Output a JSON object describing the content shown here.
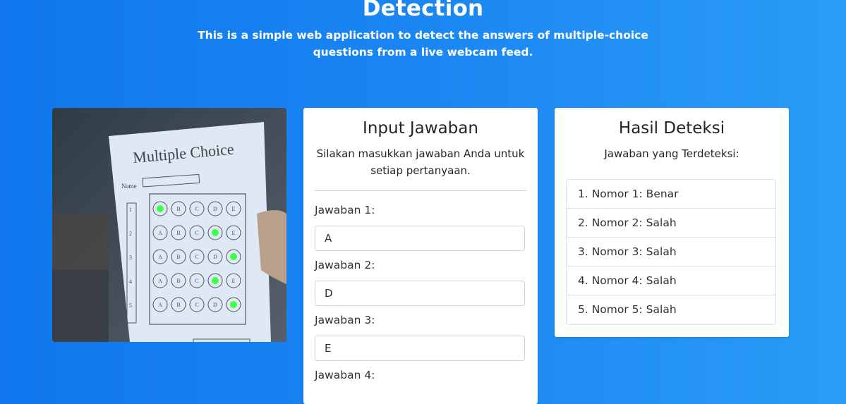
{
  "header": {
    "title": "Detection",
    "subtitle": "This is a simple web application to detect the answers of multiple-choice questions from a live webcam feed."
  },
  "webcam": {
    "sheet_title": "Multiple Choice",
    "name_label": "Name",
    "row_numbers": [
      "1",
      "2",
      "3",
      "4",
      "5"
    ],
    "options": [
      "A",
      "B",
      "C",
      "D",
      "E"
    ],
    "detected_marks": [
      {
        "row": 1,
        "option": "A"
      },
      {
        "row": 2,
        "option": "D"
      },
      {
        "row": 3,
        "option": "E"
      },
      {
        "row": 4,
        "option": "D"
      },
      {
        "row": 5,
        "option": "E"
      }
    ],
    "mark_color": "#3cff4a"
  },
  "input_card": {
    "title": "Input Jawaban",
    "description": "Silakan masukkan jawaban Anda untuk setiap pertanyaan.",
    "fields": [
      {
        "label": "Jawaban 1:",
        "value": "A"
      },
      {
        "label": "Jawaban 2:",
        "value": "D"
      },
      {
        "label": "Jawaban 3:",
        "value": "E"
      },
      {
        "label": "Jawaban 4:",
        "value": ""
      }
    ]
  },
  "result_card": {
    "title": "Hasil Deteksi",
    "subtitle": "Jawaban yang Terdeteksi:",
    "items": [
      "1. Nomor 1: Benar",
      "2. Nomor 2: Salah",
      "3. Nomor 3: Salah",
      "4. Nomor 4: Salah",
      "5. Nomor 5: Salah"
    ]
  }
}
